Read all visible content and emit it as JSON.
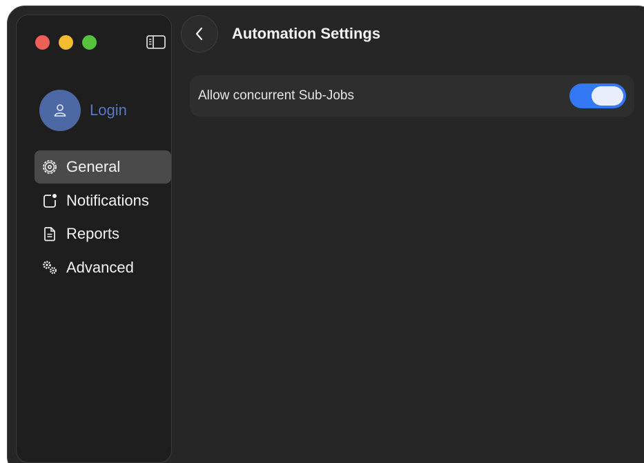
{
  "window": {
    "traffic_lights": [
      "close",
      "minimize",
      "zoom"
    ]
  },
  "sidebar": {
    "toggle_icon": "sidebar-icon",
    "login": {
      "label": "Login",
      "icon": "user-icon"
    },
    "items": [
      {
        "label": "General",
        "icon": "gear-icon",
        "active": true
      },
      {
        "label": "Notifications",
        "icon": "notification-badge-icon",
        "active": false
      },
      {
        "label": "Reports",
        "icon": "document-icon",
        "active": false
      },
      {
        "label": "Advanced",
        "icon": "gears-icon",
        "active": false
      }
    ]
  },
  "header": {
    "back_icon": "chevron-left-icon",
    "title": "Automation Settings"
  },
  "settings": [
    {
      "label": "Allow concurrent Sub-Jobs",
      "enabled": true
    }
  ],
  "colors": {
    "accent": "#3478f6",
    "login": "#5a78c0",
    "avatar": "#4c69a6"
  }
}
